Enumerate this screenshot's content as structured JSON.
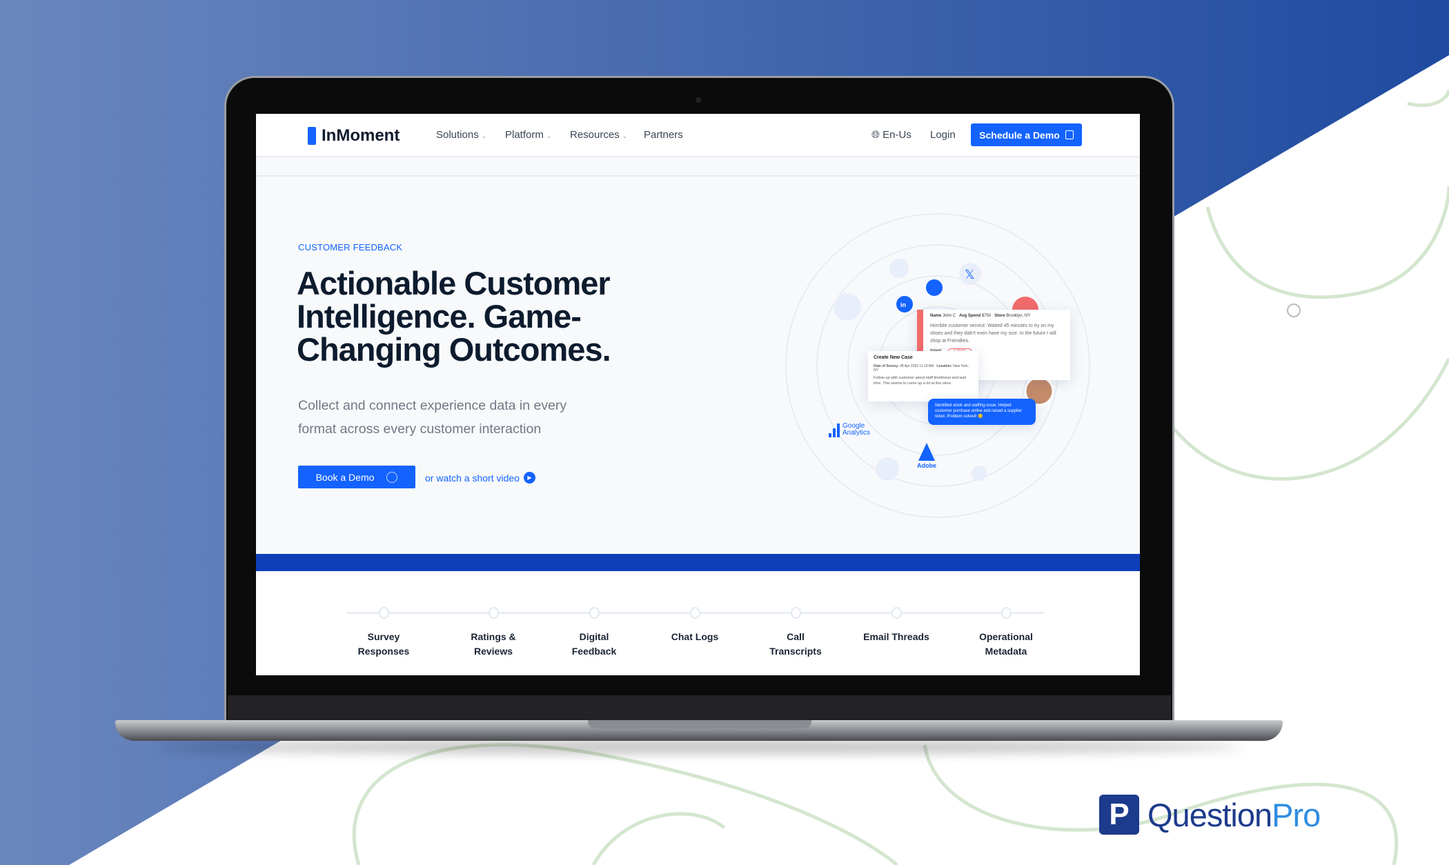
{
  "colors": {
    "accent": "#1463ff",
    "band": "#0e3fb8",
    "heading": "#0d1b2e",
    "bg_left": "#6a86bd",
    "bg_right": "#1f4ba0",
    "curves": "#d4e6cf",
    "brand_dark": "#1d3b8c",
    "brand_light": "#2f8de0"
  },
  "nav": {
    "logo": "InMoment",
    "items": [
      {
        "label": "Solutions",
        "dropdown": true
      },
      {
        "label": "Platform",
        "dropdown": true
      },
      {
        "label": "Resources",
        "dropdown": true
      },
      {
        "label": "Partners",
        "dropdown": false
      }
    ],
    "locale": "En-Us",
    "login": "Login",
    "cta": "Schedule a Demo"
  },
  "hero": {
    "eyebrow": "CUSTOMER FEEDBACK",
    "title": "Actionable Customer Intelligence. Game-Changing Outcomes.",
    "subtitle": "Collect and connect experience data in every format across every customer interaction",
    "primary_button": "Book a Demo",
    "video_link": "or watch a short video"
  },
  "illustration": {
    "review": {
      "name_label": "Name",
      "name": "John C",
      "spend_label": "Avg Spend",
      "spend": "$750",
      "store_label": "Store",
      "store": "Brooklyn, NY",
      "text": "Horrible customer service. Waited 45 minutes to try on my shoes and they didn't even have my size. In the future I will shop at Friendlies.",
      "intent_label": "Intent",
      "intent": "Churn"
    },
    "case": {
      "title": "Create New Case",
      "date_label": "Date of Survey:",
      "date": "08 Apr 2023 11:19 AM",
      "location_label": "Location:",
      "location": "New York, NY",
      "note": "Follow up with customer about staff timeliness and wait time. This seems to come up a lot at this store."
    },
    "reply": "Identified stock and staffing issue. Helped customer purchase online and raised a supplier ticket. Problem solved! 😊",
    "integrations": [
      "Google Analytics",
      "Adobe"
    ]
  },
  "timeline": [
    "Survey Responses",
    "Ratings & Reviews",
    "Digital Feedback",
    "Chat Logs",
    "Call Transcripts",
    "Email Threads",
    "Operational Metadata"
  ],
  "branding": {
    "logo_a": "Question",
    "logo_b": "Pro"
  }
}
